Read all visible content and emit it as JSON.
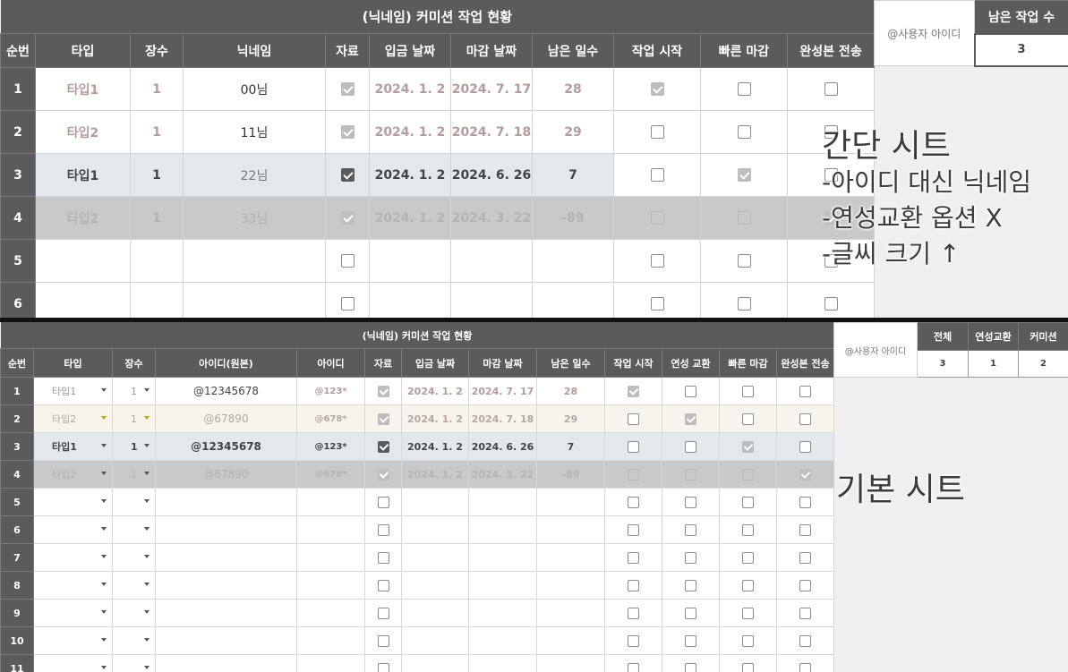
{
  "simple_sheet": {
    "title": "(닉네임) 커미션 작업 현황",
    "headers": [
      "순번",
      "타입",
      "장수",
      "닉네임",
      "자료",
      "입금 날짜",
      "마감 날짜",
      "남은 일수",
      "작업 시작",
      "빠른 마감",
      "완성본 전송"
    ],
    "user_label": "@사용자 아이디",
    "remaining_label": "남은 작업 수",
    "remaining_value": "3",
    "rows": [
      {
        "no": "1",
        "type": "타입1",
        "count": "1",
        "nick": "00님",
        "paid": "2024. 1. 2",
        "due": "2024. 7. 17",
        "days": "28"
      },
      {
        "no": "2",
        "type": "타입2",
        "count": "1",
        "nick": "11님",
        "paid": "2024. 1. 2",
        "due": "2024. 7. 18",
        "days": "29"
      },
      {
        "no": "3",
        "type": "타입1",
        "count": "1",
        "nick": "22님",
        "paid": "2024. 1. 2",
        "due": "2024. 6. 26",
        "days": "7"
      },
      {
        "no": "4",
        "type": "타입2",
        "count": "1",
        "nick": "33님",
        "paid": "2024. 1. 2",
        "due": "2024. 3. 22",
        "days": "-89"
      },
      {
        "no": "5"
      },
      {
        "no": "6"
      }
    ]
  },
  "basic_sheet": {
    "title": "(닉네임) 커미션 작업 현황",
    "headers": [
      "순번",
      "타입",
      "장수",
      "아이디(원본)",
      "아이디",
      "자료",
      "입금 날짜",
      "마감 날짜",
      "남은 일수",
      "작업 시작",
      "연성 교환",
      "빠른 마감",
      "완성본 전송"
    ],
    "user_label": "@사용자 아이디",
    "summary_headers": [
      "전체",
      "연성교환",
      "커미션"
    ],
    "summary_values": [
      "3",
      "1",
      "2"
    ],
    "rows": [
      {
        "no": "1",
        "type": "타입1",
        "count": "1",
        "id_orig": "@12345678",
        "id": "@123*",
        "paid": "2024. 1. 2",
        "due": "2024. 7. 17",
        "days": "28"
      },
      {
        "no": "2",
        "type": "타입2",
        "count": "1",
        "id_orig": "@67890",
        "id": "@678*",
        "paid": "2024. 1. 2",
        "due": "2024. 7. 18",
        "days": "29"
      },
      {
        "no": "3",
        "type": "타입1",
        "count": "1",
        "id_orig": "@12345678",
        "id": "@123*",
        "paid": "2024. 1. 2",
        "due": "2024. 6. 26",
        "days": "7"
      },
      {
        "no": "4",
        "type": "타입2",
        "count": "1",
        "id_orig": "@67890",
        "id": "@678*",
        "paid": "2024. 1. 2",
        "due": "2024. 3. 22",
        "days": "-89"
      },
      {
        "no": "5"
      },
      {
        "no": "6"
      },
      {
        "no": "7"
      },
      {
        "no": "8"
      },
      {
        "no": "9"
      },
      {
        "no": "10"
      },
      {
        "no": "11"
      }
    ]
  },
  "annotations": {
    "simple_title": "간단 시트",
    "simple_note1": "-아이디 대신 닉네임",
    "simple_note2": "-연성교환 옵션 X",
    "simple_note3": "-글씨 크기 ↑",
    "basic_title": "기본 시트"
  }
}
